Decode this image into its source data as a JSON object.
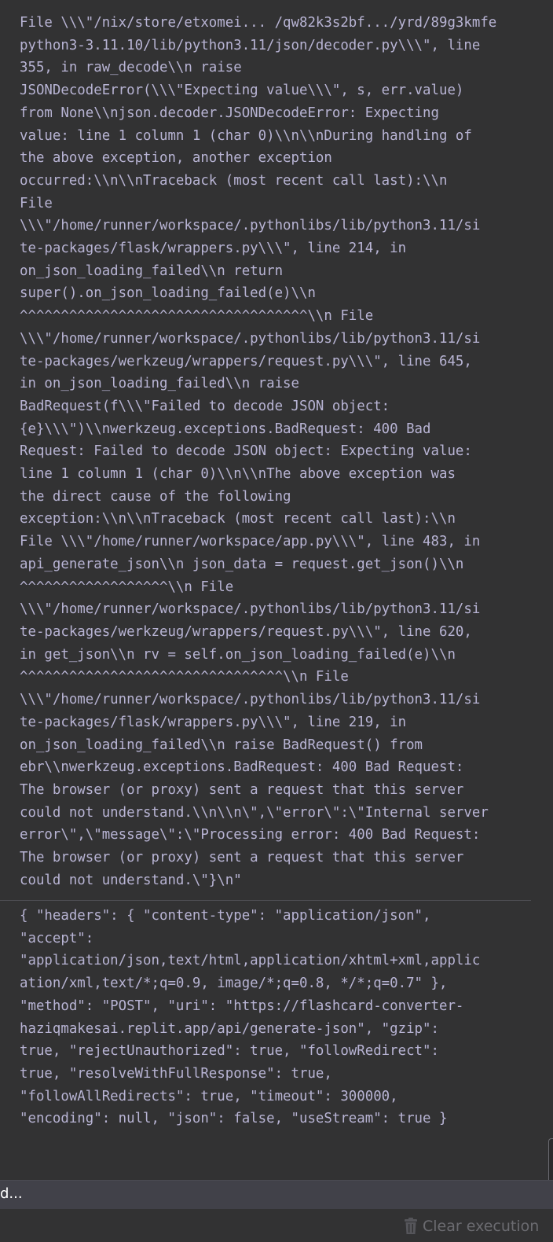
{
  "output": {
    "error_lines": [
      "File \\\\\\\"/nix/store/etxomei... /qw82k3s2bf.../yrd/89g3kmfe",
      "python3-3.11.10/lib/python3.11/json/decoder.py\\\\\\\", line",
      "355, in raw_decode\\\\n raise",
      "JSONDecodeError(\\\\\\\"Expecting value\\\\\\\", s, err.value)",
      "from None\\\\njson.decoder.JSONDecodeError: Expecting",
      "value: line 1 column 1 (char 0)\\\\n\\\\nDuring handling of",
      "the above exception, another exception",
      "occurred:\\\\n\\\\nTraceback (most recent call last):\\\\n",
      "File",
      "\\\\\\\"/home/runner/workspace/.pythonlibs/lib/python3.11/si",
      "te-packages/flask/wrappers.py\\\\\\\", line 214, in",
      "on_json_loading_failed\\\\n return",
      "super().on_json_loading_failed(e)\\\\n",
      "^^^^^^^^^^^^^^^^^^^^^^^^^^^^^^^^^^^\\\\n File",
      "\\\\\\\"/home/runner/workspace/.pythonlibs/lib/python3.11/si",
      "te-packages/werkzeug/wrappers/request.py\\\\\\\", line 645,",
      "in on_json_loading_failed\\\\n raise",
      "BadRequest(f\\\\\\\"Failed to decode JSON object:",
      "{e}\\\\\\\")\\\\nwerkzeug.exceptions.BadRequest: 400 Bad",
      "Request: Failed to decode JSON object: Expecting value:",
      "line 1 column 1 (char 0)\\\\n\\\\nThe above exception was",
      "the direct cause of the following",
      "exception:\\\\n\\\\nTraceback (most recent call last):\\\\n",
      "File \\\\\\\"/home/runner/workspace/app.py\\\\\\\", line 483, in",
      "api_generate_json\\\\n json_data = request.get_json()\\\\n",
      "^^^^^^^^^^^^^^^^^^\\\\n File",
      "\\\\\\\"/home/runner/workspace/.pythonlibs/lib/python3.11/si",
      "te-packages/werkzeug/wrappers/request.py\\\\\\\", line 620,",
      "in get_json\\\\n rv = self.on_json_loading_failed(e)\\\\n",
      "^^^^^^^^^^^^^^^^^^^^^^^^^^^^^^^^\\\\n File",
      "\\\\\\\"/home/runner/workspace/.pythonlibs/lib/python3.11/si",
      "te-packages/flask/wrappers.py\\\\\\\", line 219, in",
      "on_json_loading_failed\\\\n raise BadRequest() from",
      "ebr\\\\nwerkzeug.exceptions.BadRequest: 400 Bad Request:",
      "The browser (or proxy) sent a request that this server",
      "could not understand.\\\\n\\\\n\\\",\\\"error\\\":\\\"Internal server",
      "error\\\",\\\"message\\\":\\\"Processing error: 400 Bad Request:",
      "The browser (or proxy) sent a request that this server",
      "could not understand.\\\"}\\n\""
    ],
    "request_lines": [
      "{ \"headers\": { \"content-type\": \"application/json\",",
      "\"accept\":",
      "\"application/json,text/html,application/xhtml+xml,applic",
      "ation/xml,text/*;q=0.9, image/*;q=0.8, */*;q=0.7\" },",
      "\"method\": \"POST\", \"uri\": \"https://flashcard-converter-",
      "haziqmakesai.replit.app/api/generate-json\", \"gzip\":",
      "true, \"rejectUnauthorized\": true, \"followRedirect\":",
      "true, \"resolveWithFullResponse\": true,",
      "\"followAllRedirects\": true, \"timeout\": 300000,",
      "\"encoding\": null, \"json\": false, \"useStream\": true }"
    ]
  },
  "status_bar": {
    "text": "d..."
  },
  "footer": {
    "clear_button_label": "Clear execution",
    "clear_button_icon": "trash-icon"
  },
  "colors": {
    "background": "#323233",
    "log_text": "#b8b4d4",
    "status_bar_bg": "#414149",
    "muted_button_text": "#6b6b70"
  }
}
